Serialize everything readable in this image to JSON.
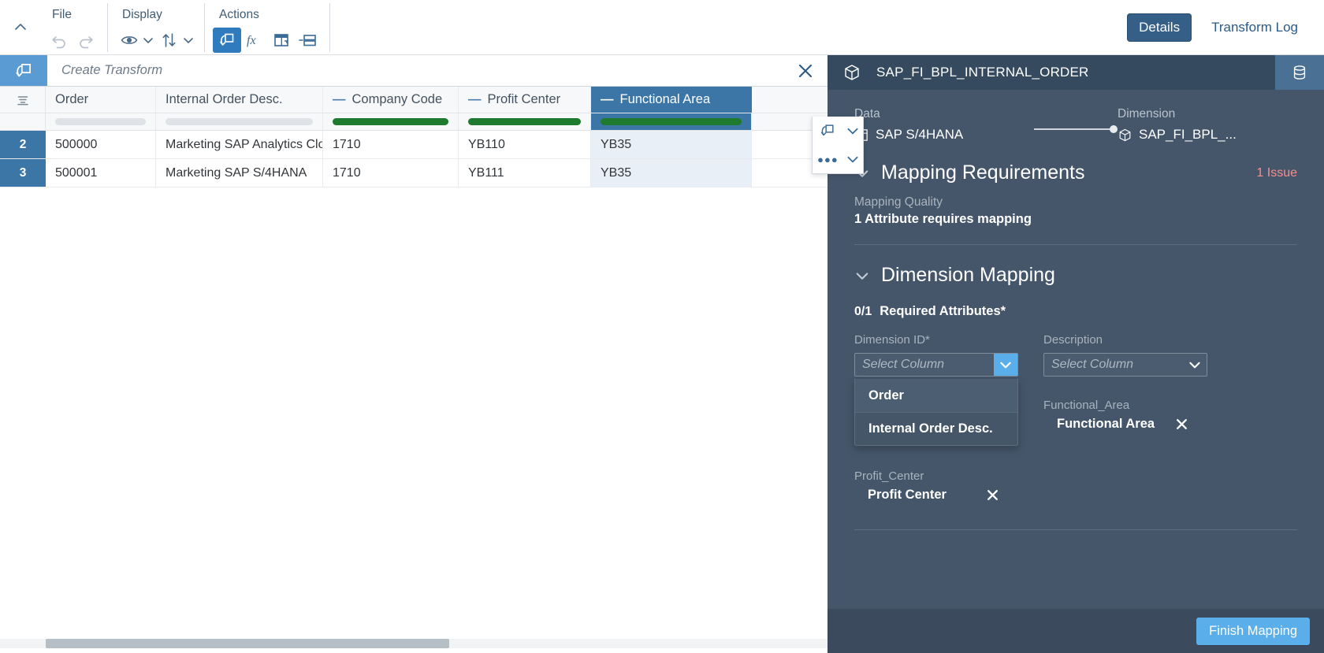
{
  "toolbar": {
    "collapse_icon": "chevron-up-icon",
    "groups": [
      {
        "title": "File",
        "items": [
          {
            "name": "undo-button",
            "icon": "undo-icon",
            "disabled": true
          },
          {
            "name": "redo-button",
            "icon": "redo-icon",
            "disabled": true
          }
        ]
      },
      {
        "title": "Display",
        "items": [
          {
            "name": "visibility-button",
            "icon": "eye-icon"
          },
          {
            "name": "sort-button",
            "icon": "sort-arrows-icon"
          }
        ]
      },
      {
        "title": "Actions",
        "items": [
          {
            "name": "create-transform-button",
            "icon": "transform-icon",
            "active": true
          },
          {
            "name": "formula-button",
            "icon": "fx-icon"
          },
          {
            "name": "column-action-button",
            "icon": "column-transform-icon"
          },
          {
            "name": "row-action-button",
            "icon": "row-filter-icon"
          }
        ]
      }
    ],
    "tabs": [
      {
        "label": "Details",
        "selected": true
      },
      {
        "label": "Transform Log",
        "selected": false
      }
    ]
  },
  "transform_bar": {
    "icon": "transform-icon",
    "title": "Create Transform",
    "close_icon": "close-icon"
  },
  "table": {
    "gutter_icon": "filter-rows-icon",
    "columns": [
      {
        "id": "order",
        "label": "Order",
        "has_dash": false,
        "quality": "grey",
        "selected": false
      },
      {
        "id": "internal_order_desc",
        "label": "Internal Order Desc.",
        "has_dash": false,
        "quality": "grey",
        "selected": false
      },
      {
        "id": "company_code",
        "label": "Company Code",
        "has_dash": true,
        "quality": "green",
        "selected": false
      },
      {
        "id": "profit_center",
        "label": "Profit Center",
        "has_dash": true,
        "quality": "green",
        "selected": false
      },
      {
        "id": "functional_area",
        "label": "Functional Area",
        "has_dash": true,
        "quality": "green",
        "selected": true
      }
    ],
    "rows": [
      {
        "num": "2",
        "cells": [
          "500000",
          "Marketing SAP Analytics Clou",
          "1710",
          "YB110",
          "YB35"
        ]
      },
      {
        "num": "3",
        "cells": [
          "500001",
          "Marketing SAP S/4HANA",
          "1710",
          "YB111",
          "YB35"
        ]
      }
    ]
  },
  "column_actions": {
    "transform_icon": "transform-icon",
    "transform_caret": "chevron-down-icon",
    "more_icon": "overflow-dots-icon",
    "more_caret": "chevron-down-icon"
  },
  "side_panel": {
    "header": {
      "icon": "cube-icon",
      "title": "SAP_FI_BPL_INTERNAL_ORDER",
      "db_icon": "database-icon"
    },
    "connection": {
      "data_label": "Data",
      "data_value": "SAP S/4HANA",
      "data_icon": "table-data-icon",
      "dimension_label": "Dimension",
      "dimension_value": "SAP_FI_BPL_...",
      "dimension_icon": "cube-icon"
    },
    "mapping_requirements": {
      "chevron": "chevron-down-icon",
      "title": "Mapping Requirements",
      "issue": "1 Issue",
      "quality_label": "Mapping Quality",
      "quality_value": "1 Attribute requires mapping"
    },
    "dimension_mapping": {
      "chevron": "chevron-down-icon",
      "title": "Dimension Mapping",
      "required_count": "0/1",
      "required_label": "Required Attributes*",
      "dimension_id": {
        "label": "Dimension ID*",
        "placeholder": "Select Column",
        "arrow_icon": "chevron-down-icon",
        "options": [
          {
            "label": "Order",
            "highlighted": true
          },
          {
            "label": "Internal Order Desc.",
            "highlighted": false
          }
        ]
      },
      "description": {
        "label": "Description",
        "placeholder": "Select Column",
        "arrow_icon": "chevron-down-icon"
      },
      "mapped": [
        {
          "group": "Functional_Area",
          "value": "Functional Area",
          "remove_icon": "close-icon",
          "column": "right"
        },
        {
          "group": "Profit_Center",
          "value": "Profit Center",
          "remove_icon": "close-icon",
          "column": "left"
        }
      ]
    },
    "footer": {
      "finish_label": "Finish Mapping"
    }
  },
  "colors": {
    "accent_blue": "#3c76a6",
    "bright_blue": "#5aafeb",
    "panel_bg": "#45566a",
    "panel_header": "#354a5f",
    "quality_green": "#1e7a2e",
    "issue_red": "#f58e8e"
  }
}
